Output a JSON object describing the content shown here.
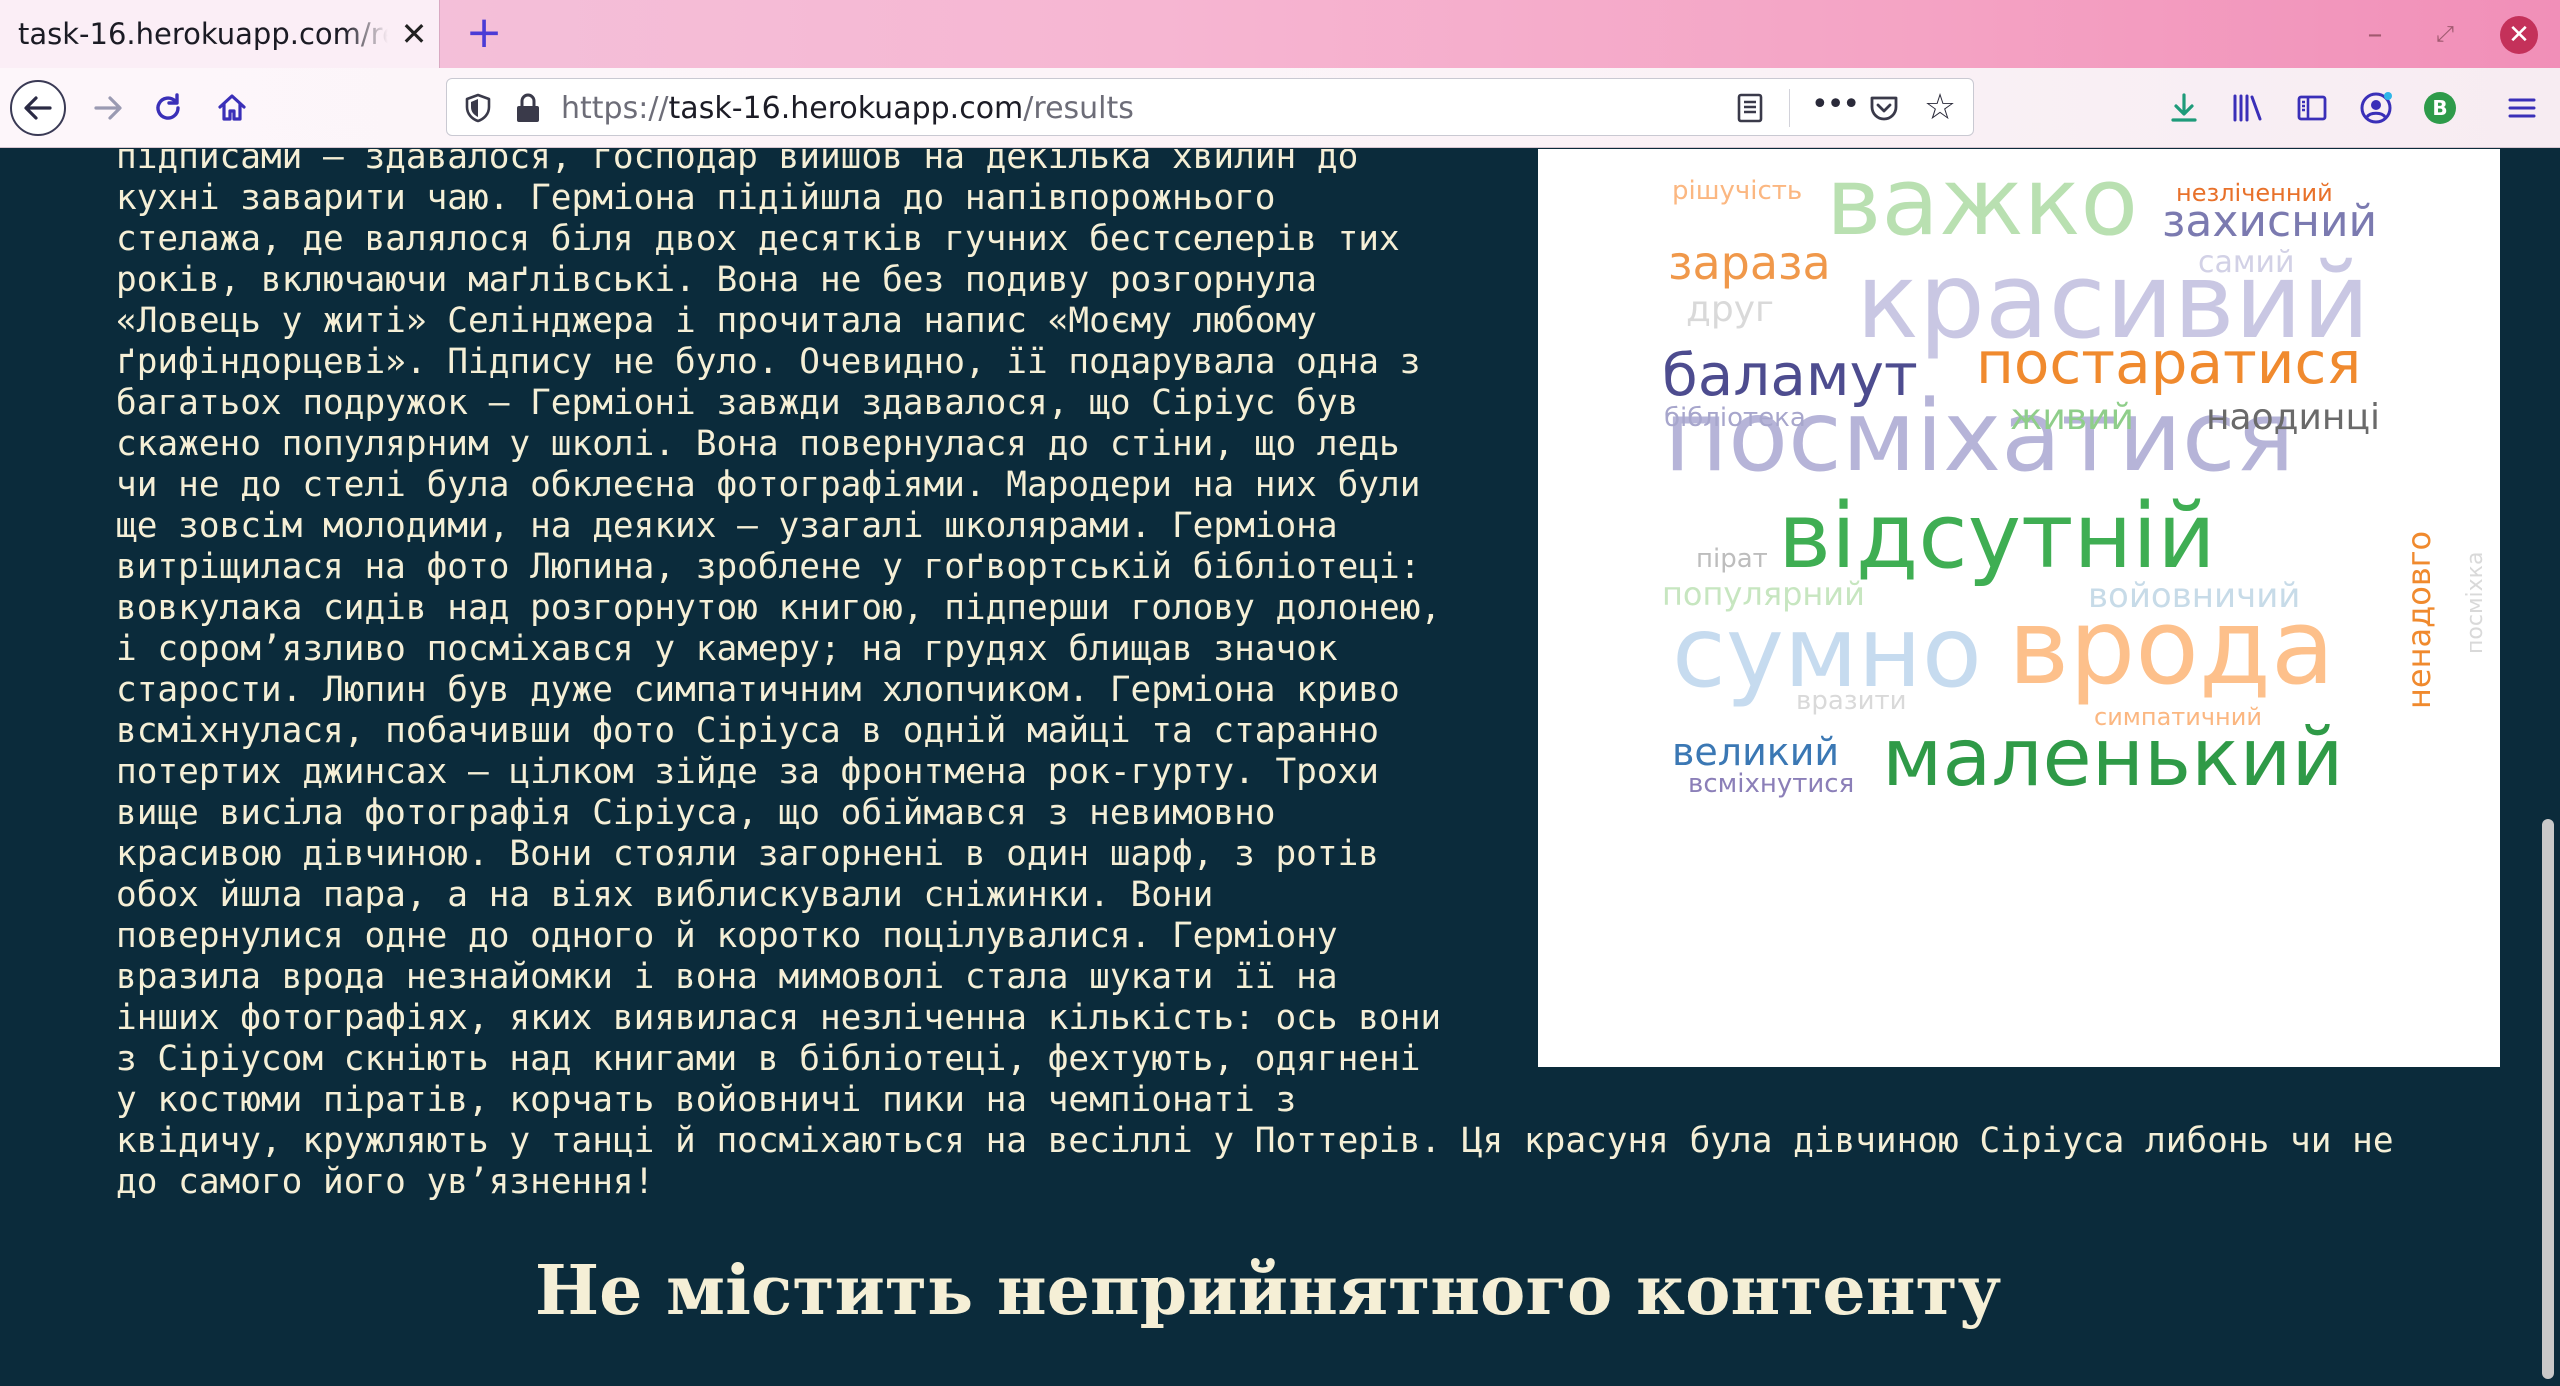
{
  "browser": {
    "tab_title": "task-16.herokuapp.com/results",
    "url_scheme": "https://",
    "url_host": "task-16.herokuapp.com",
    "url_path": "/results",
    "profile_initial": "B"
  },
  "page": {
    "story_lines": [
      "підписами – здавалося, господар вийшов на декілька хвилин до",
      "кухні заварити чаю. Герміона підійшла до напівпорожнього",
      "стелажа, де валялося біля двох десятків гучних бестселерів тих",
      "років, включаючи маґлівські. Вона не без подиву розгорнула",
      "«Ловець у житі» Селінджера і прочитала напис «Моєму любому",
      "ґрифіндорцеві». Підпису не було. Очевидно, її подарувала одна з",
      "багатьох подружок – Герміоні завжди здавалося, що Сіріус був",
      "скажено популярним у школі. Вона повернулася до стіни, що ледь",
      "чи не до стелі була обклеєна фотографіями. Мародери на них були",
      "ще зовсім молодими, на деяких – узагалі школярами. Герміона",
      "витріщилася на фото Люпина, зроблене у гоґвортській бібліотеці:",
      "вовкулака сидів над розгорнутою книгою, підперши голову долонею,",
      "і сором’язливо посміхався у камеру; на грудях блищав значок",
      "старости. Люпин був дуже симпатичним хлопчиком. Герміона криво",
      "всміхнулася, побачивши фото Сіріуса в одній майці та старанно",
      "потертих джинсах – цілком зійде за фронтмена рок-гурту. Трохи",
      "вище висіла фотографія Сіріуса, що обіймався з невимовно",
      "красивою дівчиною. Вони стояли загорнені в один шарф, з ротів",
      "обох йшла пара, а на віях виблискували сніжинки. Вони",
      "повернулися одне до одного й коротко поцілувалися. Герміону",
      "вразила врода незнайомки і вона мимоволі стала шукати її на",
      "інших фотографіях, яких виявилася незліченна кількість: ось вони",
      "з Сіріусом скніють над книгами в бібліотеці, фехтують, одягнені",
      "у костюми піратів, корчать войовничі пики на чемпіонаті з",
      "квідичу, кружляють у танці й посміхаються на весіллі у Поттерів. Ця красуня була дівчиною Сіріуса либонь чи не",
      "до самого його ув’язнення!"
    ],
    "verdict": "Не містить неприйнятного контенту"
  },
  "word_cloud": {
    "words": [
      {
        "text": "важко",
        "color": "#b9e0b1"
      },
      {
        "text": "красивий",
        "color": "#c9c7e3"
      },
      {
        "text": "посміхатися",
        "color": "#b6b4d8"
      },
      {
        "text": "відсутній",
        "color": "#3fae53"
      },
      {
        "text": "сумно",
        "color": "#c6dbef"
      },
      {
        "text": "врода",
        "color": "#fdc08b"
      },
      {
        "text": "маленький",
        "color": "#2f9a47"
      },
      {
        "text": "постаратися",
        "color": "#f08a2e"
      },
      {
        "text": "баламут",
        "color": "#4d4c8f"
      },
      {
        "text": "зараза",
        "color": "#f0984a"
      },
      {
        "text": "захисний",
        "color": "#7b7ab0"
      },
      {
        "text": "незліченний",
        "color": "#e8712a"
      },
      {
        "text": "рішучість",
        "color": "#fbb781"
      },
      {
        "text": "самий",
        "color": "#d2d1e6"
      },
      {
        "text": "друг",
        "color": "#d9d9d9"
      },
      {
        "text": "живий",
        "color": "#8fce8a"
      },
      {
        "text": "наодинці",
        "color": "#6a6a6a"
      },
      {
        "text": "бібліотека",
        "color": "#a7a6cc"
      },
      {
        "text": "пірат",
        "color": "#bdbdbd"
      },
      {
        "text": "популярний",
        "color": "#c7e6c0"
      },
      {
        "text": "войовничий",
        "color": "#c7dbe8"
      },
      {
        "text": "ненадовго",
        "color": "#f08a2e"
      },
      {
        "text": "посміхка",
        "color": "#d9d9d9"
      },
      {
        "text": "вразити",
        "color": "#d9d9d9"
      },
      {
        "text": "симпатичний",
        "color": "#fbb781"
      },
      {
        "text": "великий",
        "color": "#3b78b4"
      },
      {
        "text": "всміхнутися",
        "color": "#8b7fb8"
      }
    ]
  }
}
